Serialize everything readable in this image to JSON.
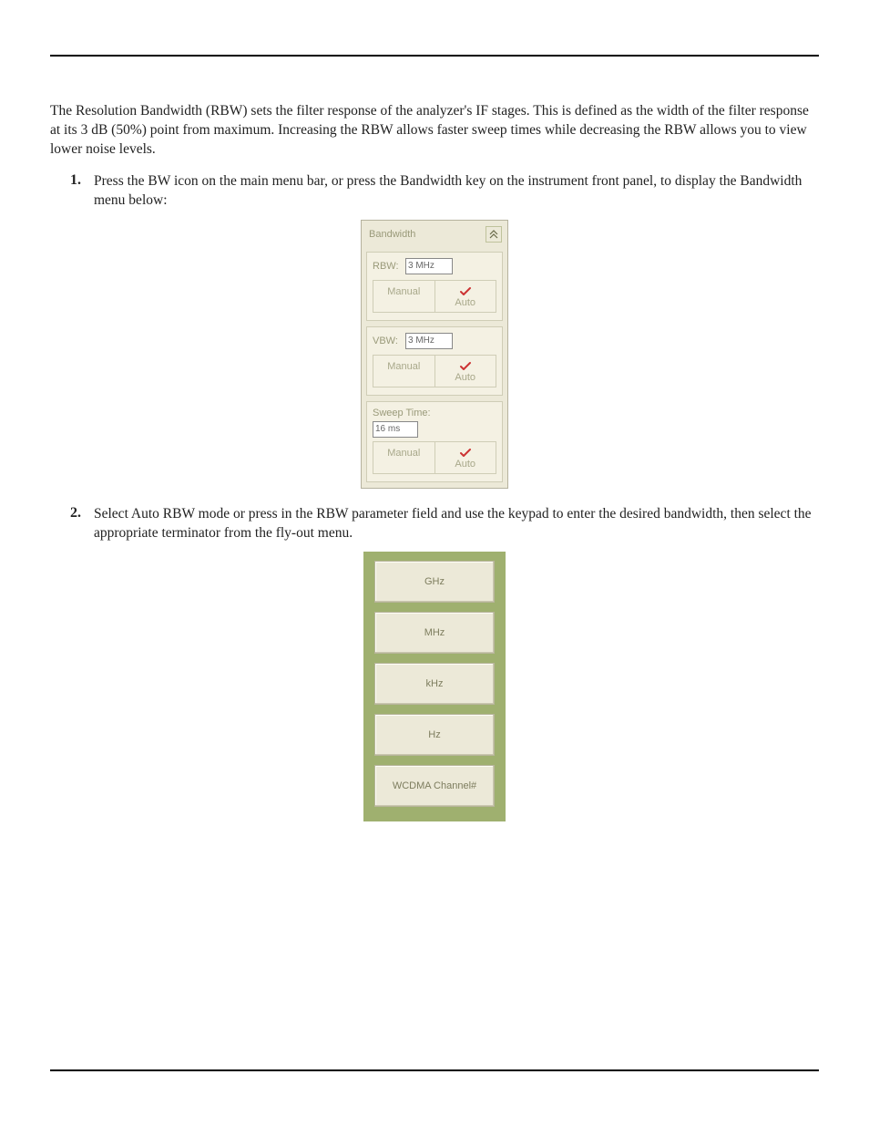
{
  "intro_paragraph": "The Resolution Bandwidth (RBW) sets the filter response of the analyzer's IF stages. This is defined as the width of the filter response at its 3 dB (50%) point from maximum. Increasing the RBW allows faster sweep times while decreasing the RBW allows you to view lower noise levels.",
  "steps": {
    "s1_num": "1.",
    "s1_text": "Press the BW icon on the main menu bar, or press the Bandwidth key on the instrument front panel, to display the Bandwidth menu below:",
    "s2_num": "2.",
    "s2_text": "Select Auto RBW mode or press in the RBW parameter field and use the keypad to enter the desired bandwidth, then select the appropriate terminator from the fly-out menu."
  },
  "bw_panel": {
    "title": "Bandwidth",
    "rbw": {
      "label": "RBW:",
      "value": "3 MHz",
      "manual": "Manual",
      "auto": "Auto"
    },
    "vbw": {
      "label": "VBW:",
      "value": "3 MHz",
      "manual": "Manual",
      "auto": "Auto"
    },
    "sweep": {
      "label": "Sweep Time:",
      "value": "16 ms",
      "manual": "Manual",
      "auto": "Auto"
    }
  },
  "unit_panel": {
    "opt1": "GHz",
    "opt2": "MHz",
    "opt3": "kHz",
    "opt4": "Hz",
    "opt5": "WCDMA Channel#"
  }
}
